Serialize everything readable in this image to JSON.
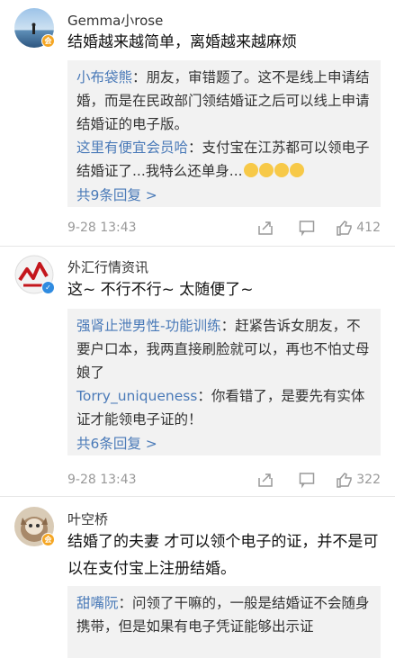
{
  "comments": [
    {
      "username": "Gemma小rose",
      "content": "结婚越来越简单，离婚越来越麻烦",
      "replies": [
        {
          "name": "小布袋熊",
          "text": "：朋友，审错题了。这不是线上申请结婚，而是在民政部门领结婚证之后可以线上申请结婚证的电子版。"
        },
        {
          "name": "这里有便宜会员哈",
          "text": "：支付宝在江苏都可以领电子结婚证了...我特么还单身..."
        }
      ],
      "more_label": "共9条回复 >",
      "time": "9-28 13:43",
      "likes": "412"
    },
    {
      "username": "外汇行情资讯",
      "content": "这~ 不行不行~ 太随便了~",
      "replies": [
        {
          "name": "强肾止泄男性-功能训练",
          "text": "：赶紧告诉女朋友，不要户口本，我两直接刷脸就可以，再也不怕丈母娘了"
        },
        {
          "name": "Torry_uniqueness",
          "text": "：你看错了，是要先有实体证才能领电子证的！"
        }
      ],
      "more_label": "共6条回复 >",
      "time": "9-28 13:43",
      "likes": "322"
    },
    {
      "username": "叶空桥",
      "content": "结婚了的夫妻 才可以领个电子的证，并不是可以在支付宝上注册结婚。",
      "replies": [
        {
          "name": "甜嘴阮",
          "text": "：问领了干嘛的，一般是结婚证不会随身携带，但是如果有电子凭证能够出示证"
        }
      ]
    }
  ],
  "badges": {
    "c1": "会",
    "c2": "✓",
    "c3": "会"
  },
  "colors": {
    "link": "#4a7ab8",
    "reply_bg": "#f2f2f2",
    "badge_orange": "#f5a623",
    "badge_blue": "#2f8be0"
  },
  "icons": [
    "share-icon",
    "comment-icon",
    "like-icon"
  ]
}
